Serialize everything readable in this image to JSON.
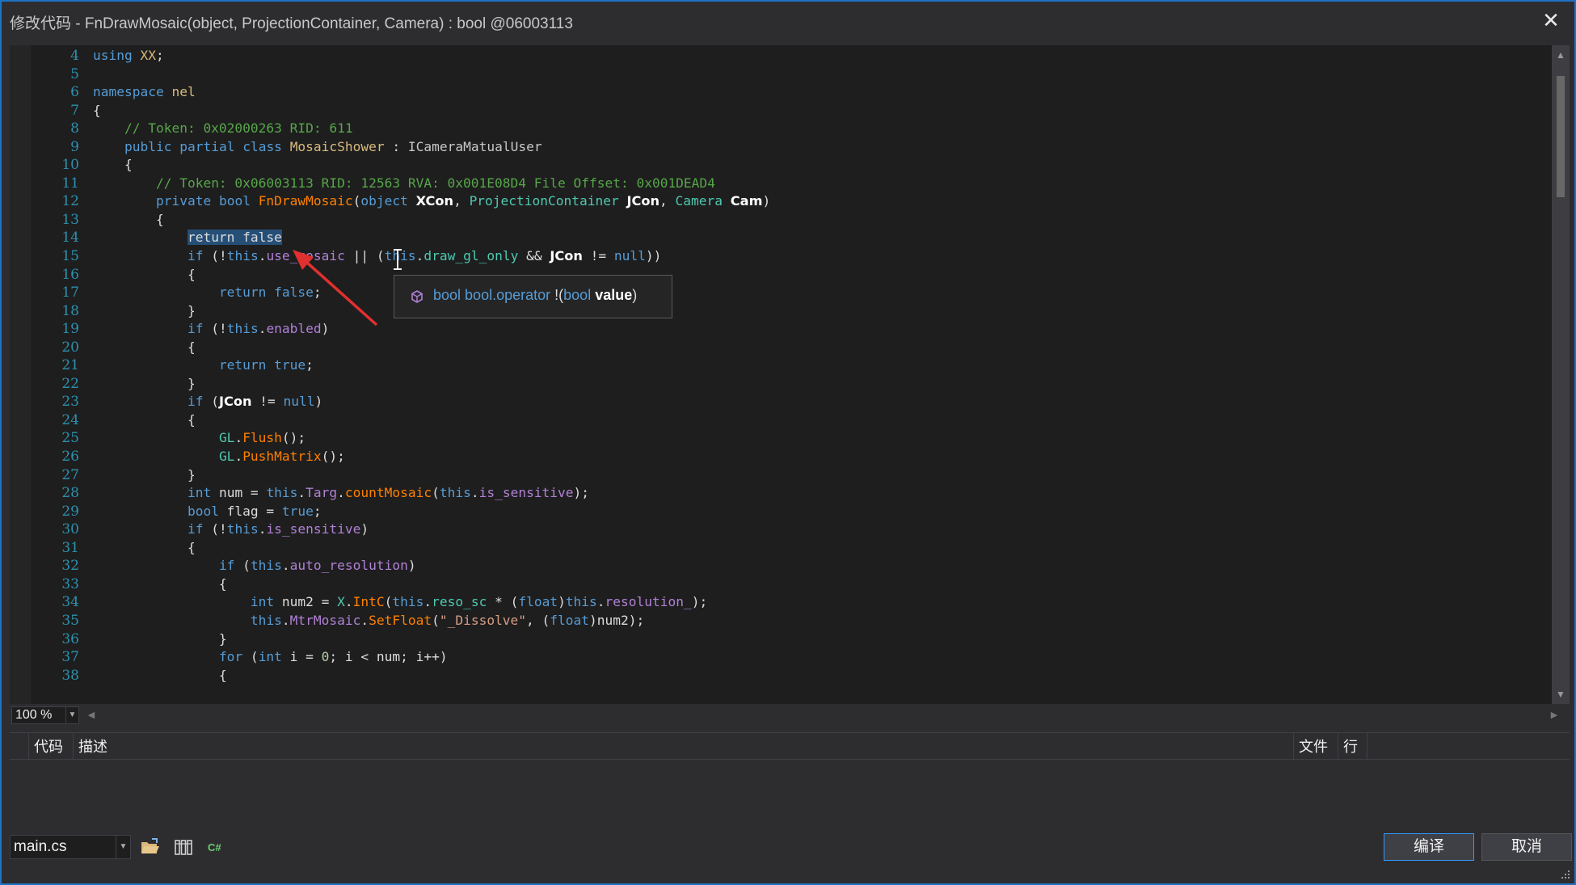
{
  "window": {
    "title": "修改代码 - FnDrawMosaic(object, ProjectionContainer, Camera) : bool @06003113",
    "close_symbol": "✕"
  },
  "editor": {
    "line_numbers": [
      "4",
      "5",
      "6",
      "7",
      "8",
      "9",
      "10",
      "11",
      "12",
      "13",
      "14",
      "15",
      "16",
      "17",
      "18",
      "19",
      "20",
      "21",
      "22",
      "23",
      "24",
      "25",
      "26",
      "27",
      "28",
      "29",
      "30",
      "31",
      "32",
      "33",
      "34",
      "35",
      "36",
      "37",
      "38"
    ],
    "selected_text": "return false"
  },
  "tooltip": {
    "return_type": "bool",
    "member": "bool.operator",
    "operator_symbol": "!",
    "open_paren": "(",
    "param_type": "bool",
    "param_name": "value",
    "close_paren": ")"
  },
  "zoom": {
    "value": "100 %"
  },
  "error_list": {
    "columns": [
      "代码",
      "描述",
      "文件",
      "行"
    ]
  },
  "footer": {
    "file_selector_value": "main.cs",
    "compile_label": "编译",
    "cancel_label": "取消",
    "lang_badge": "C#"
  },
  "colors": {
    "window_border": "#1e73c4",
    "editor_bg": "#1e1e1e",
    "chrome_bg": "#2d2d30",
    "keyword": "#569cd6",
    "comment": "#57a64a",
    "method": "#ff8000",
    "property": "#b180d7",
    "line_number": "#2b91af",
    "selection": "#264f78",
    "annotation_arrow": "#e0302f"
  }
}
